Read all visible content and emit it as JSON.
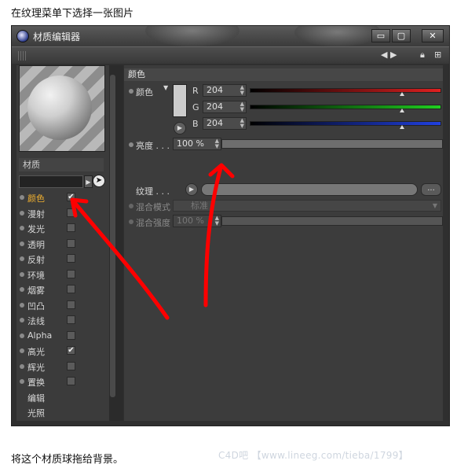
{
  "captions": {
    "top": "在纹理菜单下选择一张图片",
    "bottom": "将这个材质球拖给背景。",
    "watermark": "C4D吧 【www.lineeg.com/tieba/1799】"
  },
  "window": {
    "title": "材质编辑器",
    "buttons": [
      "▭",
      "▢",
      "✕"
    ]
  },
  "material": {
    "name": "材质",
    "channels": [
      {
        "label": "颜色",
        "checked": true,
        "active": true
      },
      {
        "label": "漫射",
        "checked": false
      },
      {
        "label": "发光",
        "checked": false
      },
      {
        "label": "透明",
        "checked": false
      },
      {
        "label": "反射",
        "checked": false
      },
      {
        "label": "环境",
        "checked": false
      },
      {
        "label": "烟雾",
        "checked": false
      },
      {
        "label": "凹凸",
        "checked": false
      },
      {
        "label": "法线",
        "checked": false
      },
      {
        "label": "Alpha",
        "checked": false
      },
      {
        "label": "高光",
        "checked": true
      },
      {
        "label": "辉光",
        "checked": false
      },
      {
        "label": "置换",
        "checked": false
      },
      {
        "label": "编辑",
        "checked": null
      },
      {
        "label": "光照",
        "checked": null
      }
    ]
  },
  "color_section": {
    "header": "颜色",
    "color_label": "颜色",
    "swatch_color": "#cccccc",
    "r_label": "R",
    "r_value": "204",
    "g_label": "G",
    "g_value": "204",
    "b_label": "B",
    "b_value": "204",
    "brightness_label": "亮度 . . .",
    "brightness_value": "100 %",
    "texture_label": "纹理 . . .",
    "texture_more": "...",
    "blend_mode_label": "混合模式",
    "blend_mode_value": "标准",
    "blend_strength_label": "混合强度",
    "blend_strength_value": "100 %"
  },
  "checkmark": "✔",
  "colors": {
    "accent": "#f0b030",
    "red": "#e02020",
    "green": "#20d020",
    "blue": "#2040e0",
    "annotation": "#ff0000"
  }
}
